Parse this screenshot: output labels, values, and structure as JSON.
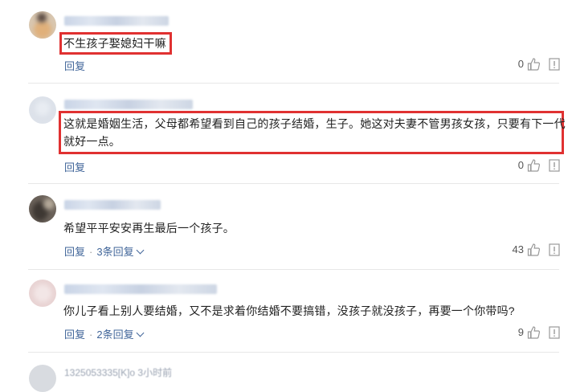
{
  "reply_label": "回复",
  "comments": [
    {
      "text": "不生孩子娶媳妇干嘛",
      "likes": "0",
      "replies_label": ""
    },
    {
      "text": "这就是婚姻生活，父母都希望看到自己的孩子结婚，生子。她这对夫妻不管男孩女孩，只要有下一代\n就好一点。",
      "likes": "0",
      "replies_label": ""
    },
    {
      "text": "希望平平安安再生最后一个孩子。",
      "likes": "43",
      "replies_label": "3条回复"
    },
    {
      "text": "你儿子看上别人要结婚，又不是求着你结婚不要搞错，没孩子就没孩子，再要一个你带吗?",
      "likes": "9",
      "replies_label": "2条回复"
    }
  ],
  "last_comment_name": "1325053335[K]o 3小时前",
  "colors": {
    "highlight": "#e03131",
    "link": "#406599",
    "text": "#222222"
  }
}
